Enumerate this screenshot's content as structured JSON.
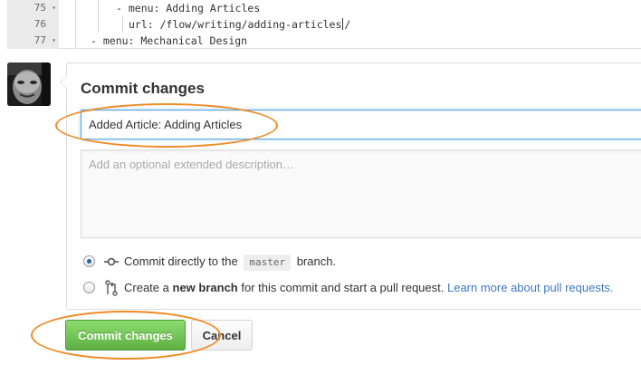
{
  "editor": {
    "lines": [
      {
        "number": "75",
        "text": "- menu: Adding Articles",
        "foldable": true
      },
      {
        "number": "76",
        "text_before_cursor": "url: /flow/writing/adding-articles",
        "text_after_cursor": "/",
        "foldable": false
      },
      {
        "number": "77",
        "text": "- menu: Mechanical Design",
        "foldable": true
      }
    ],
    "fold_glyph": "▾"
  },
  "commit": {
    "title": "Commit changes",
    "summary_value": "Added Article: Adding Articles",
    "description_placeholder": "Add an optional extended description…",
    "option_direct": {
      "prefix": "Commit directly to the",
      "branch": "master",
      "suffix": "branch.",
      "selected": true
    },
    "option_new_branch": {
      "prefix": "Create a",
      "bold": "new branch",
      "suffix": "for this commit and start a pull request.",
      "link": "Learn more about pull requests.",
      "selected": false
    },
    "commit_button": "Commit changes",
    "cancel_button": "Cancel"
  },
  "colors": {
    "highlight": "#f08a24",
    "primary_button": "#60b044",
    "link": "#4078c0",
    "focus": "#51a7e8"
  },
  "icons": {
    "direct_commit": "git-commit-icon",
    "new_branch": "git-pull-request-icon",
    "avatar": "user-avatar"
  }
}
